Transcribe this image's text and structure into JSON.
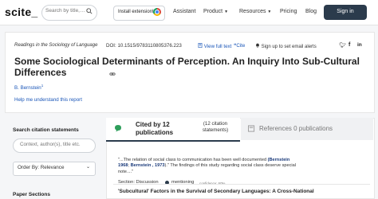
{
  "nav": {
    "logo": "scite_",
    "search_placeholder": "Search by title,…",
    "install_label": "Install extension!",
    "links": [
      "Assistant",
      "Product",
      "Resources",
      "Pricing",
      "Blog"
    ],
    "signin_label": "Sign in",
    "accent": "#2b3b4c"
  },
  "paper": {
    "journal": "Readings in the Sociology of Language",
    "doi": "DOI: 10.1515/9783110805376.223",
    "full_text_label": "View full text",
    "cite_label": "Cite",
    "alerts_label": "Sign up to set email alerts",
    "title": "Some Sociological Determinants of Perception. An Inquiry Into Sub-Cultural Differences",
    "author": "B. Bernstein",
    "author_sup": "1",
    "help_link": "Help me understand this report"
  },
  "sidebar": {
    "heading": "Search citation statements",
    "search_placeholder": "Context, author(s), title etc.",
    "order_label": "Order By: Relevance",
    "next_heading": "Paper Sections"
  },
  "tabs": {
    "cited_by": "Cited by 12 publications",
    "cited_sub": "(12 citation statements)",
    "references": "References 0 publications"
  },
  "citation": {
    "snippet_pre": "\"...The relation of social class to communication has been well documented ",
    "ref1": "(Bernstein 1968",
    "snippet_mid": "; ",
    "ref2": "Bernstein , 1973",
    "snippet_post": ").\" The findings of this study regarding social class deserve special note....\"",
    "section_label": "Section: Discussion",
    "mentioning_label": "mentioning",
    "confidence": "confidence: 60%",
    "result_title": "'Subcultural' Factors in the Survival of Secondary Languages: A Cross-National"
  }
}
